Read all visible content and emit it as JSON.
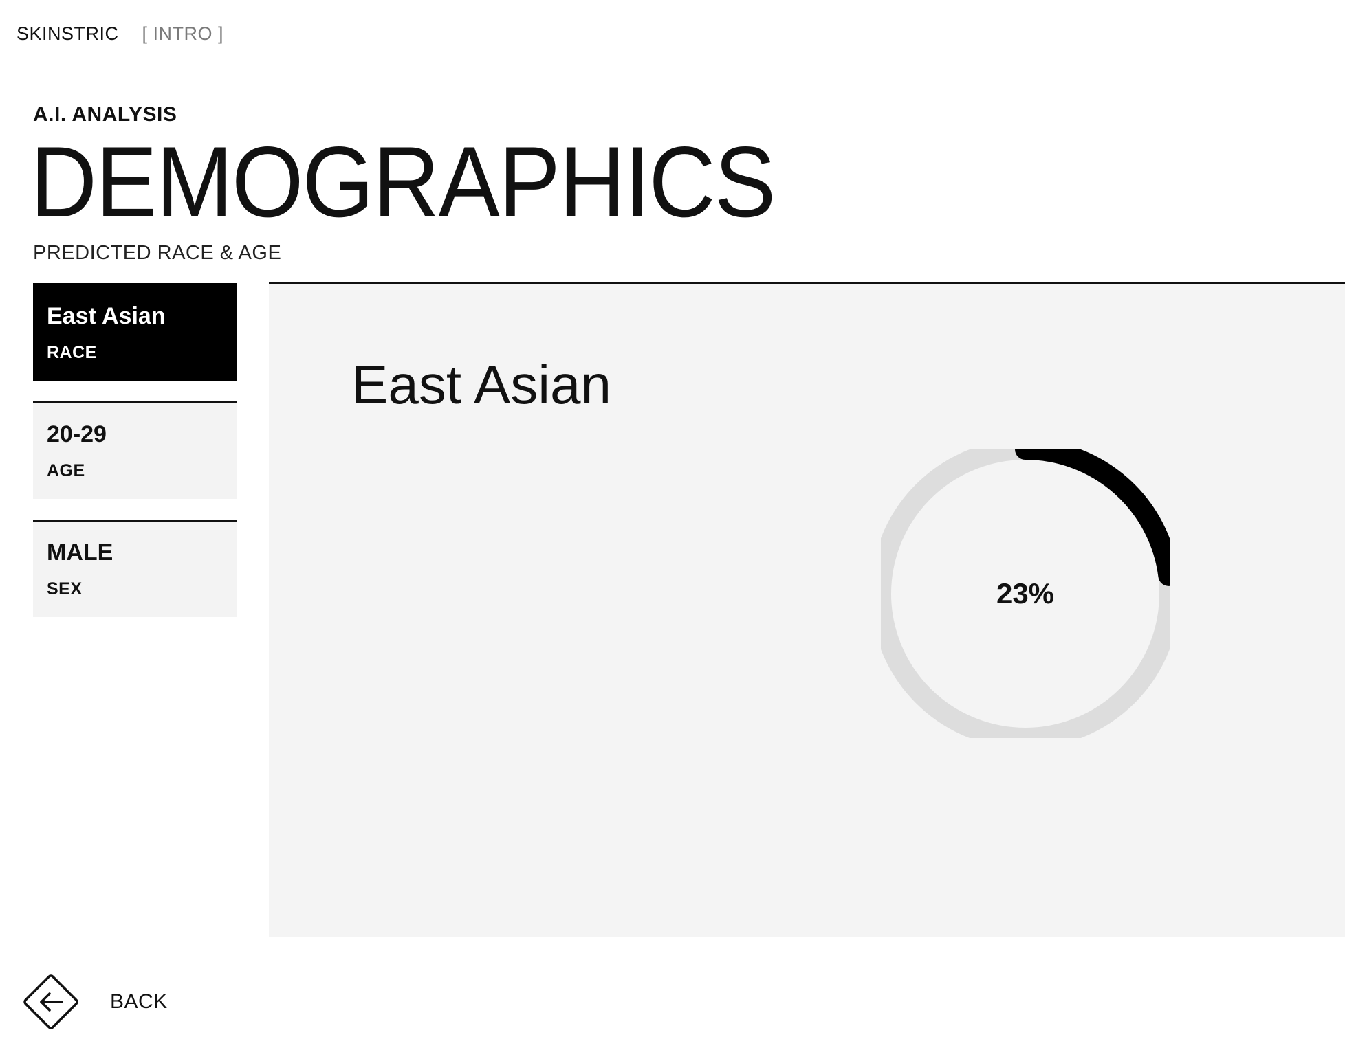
{
  "header": {
    "brand": "SKINSTRIC",
    "breadcrumb": "[ INTRO ]"
  },
  "intro": {
    "eyebrow": "A.I. ANALYSIS",
    "title": "DEMOGRAPHICS",
    "subtitle": "PREDICTED RACE & AGE"
  },
  "sidebar": {
    "items": [
      {
        "value": "East Asian",
        "label": "RACE",
        "active": true
      },
      {
        "value": "20-29",
        "label": "AGE",
        "active": false
      },
      {
        "value": "MALE",
        "label": "SEX",
        "active": false
      }
    ]
  },
  "main": {
    "heading": "East Asian",
    "confidence_text": "23%",
    "confidence_fraction": 0.23
  },
  "footer": {
    "back_label": "BACK"
  },
  "colors": {
    "accent": "#000000",
    "panel_bg": "#f4f4f4",
    "ring_track": "#dddddd"
  },
  "icons": {
    "back": "arrow-left-icon"
  }
}
